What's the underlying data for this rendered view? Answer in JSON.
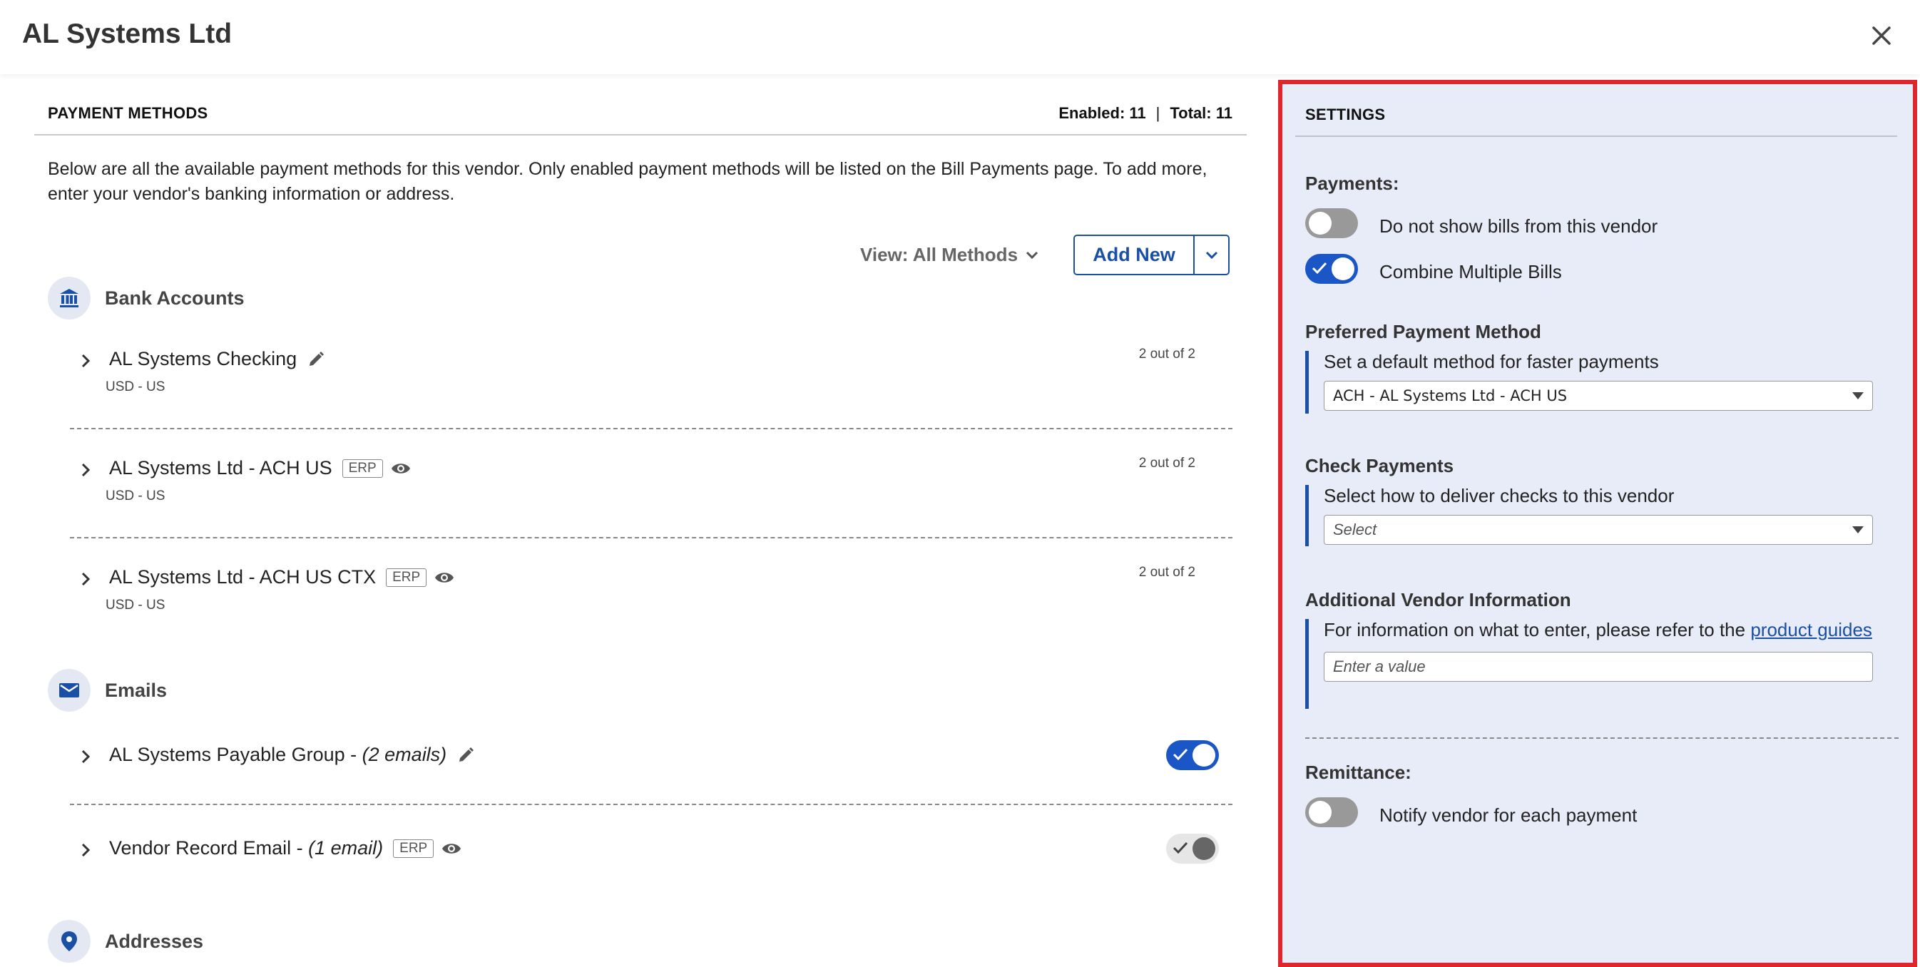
{
  "header": {
    "title": "AL Systems Ltd",
    "close_icon": "close-icon"
  },
  "payment_methods": {
    "section_title": "PAYMENT METHODS",
    "enabled_label": "Enabled: 11",
    "separator": "|",
    "total_label": "Total: 11",
    "intro": "Below are all the available payment methods for this vendor. Only enabled payment methods will be listed on the Bill Payments page. To add more, enter your vendor's banking information or address.",
    "view_label": "View: All Methods",
    "add_new_label": "Add New",
    "bank_accounts": {
      "label": "Bank Accounts",
      "icon": "bank-icon",
      "items": [
        {
          "name": "AL Systems Checking",
          "sub": "USD - US",
          "count": "2 out of 2",
          "erp": "",
          "icon": "pencil-icon"
        },
        {
          "name": "AL Systems Ltd - ACH US",
          "sub": "USD - US",
          "count": "2 out of 2",
          "erp": "ERP",
          "icon": "eye-icon"
        },
        {
          "name": "AL Systems Ltd - ACH US CTX",
          "sub": "USD - US",
          "count": "2 out of 2",
          "erp": "ERP",
          "icon": "eye-icon"
        }
      ]
    },
    "emails": {
      "label": "Emails",
      "icon": "mail-icon",
      "items": [
        {
          "name": "AL Systems Payable Group - ",
          "detail": "(2 emails)",
          "erp": "",
          "icon": "pencil-icon",
          "enabled": true
        },
        {
          "name": "Vendor Record Email - ",
          "detail": "(1 email)",
          "erp": "ERP",
          "icon": "eye-icon",
          "enabled": true,
          "locked": true
        }
      ]
    },
    "addresses": {
      "label": "Addresses",
      "icon": "location-pin-icon"
    }
  },
  "settings": {
    "title": "SETTINGS",
    "payments_label": "Payments:",
    "hide_bills_label": "Do not show bills from this vendor",
    "hide_bills_on": false,
    "combine_label": "Combine Multiple Bills",
    "combine_on": true,
    "preferred_label": "Preferred Payment Method",
    "preferred_desc": "Set a default method for faster payments",
    "preferred_value": "ACH - AL Systems Ltd - ACH US",
    "check_label": "Check Payments",
    "check_desc": "Select how to deliver checks to this vendor",
    "check_placeholder": "Select",
    "additional_label": "Additional Vendor Information",
    "additional_desc": "For information on what to enter, please refer to the ",
    "additional_link": "product guides",
    "additional_placeholder": "Enter a value",
    "remittance_label": "Remittance:",
    "notify_label": "Notify vendor for each payment",
    "notify_on": false
  }
}
